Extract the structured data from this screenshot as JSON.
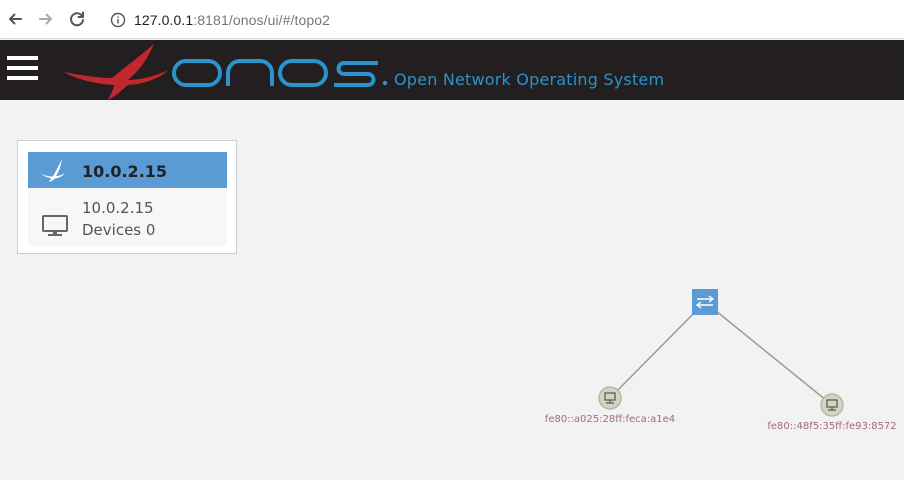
{
  "browser": {
    "url_host": "127.0.0.1",
    "url_rest": ":8181/onos/ui/#/topo2"
  },
  "masthead": {
    "logo_text": "onos",
    "tagline": "Open Network Operating System"
  },
  "summary": {
    "title": "10.0.2.15",
    "instance_ip": "10.0.2.15",
    "devices_text": "Devices 0"
  },
  "topology": {
    "switch": {
      "name": "switch"
    },
    "hosts": [
      {
        "label": "fe80::a025:28ff:feca:a1e4"
      },
      {
        "label": "fe80::48f5:35ff:fe93:8572"
      }
    ]
  },
  "colors": {
    "masthead_bg": "#231f20",
    "brand_blue": "#2a93cc",
    "brand_red": "#c2272d",
    "panel_header": "#5b9bd5",
    "host_label": "#a56a7a"
  }
}
